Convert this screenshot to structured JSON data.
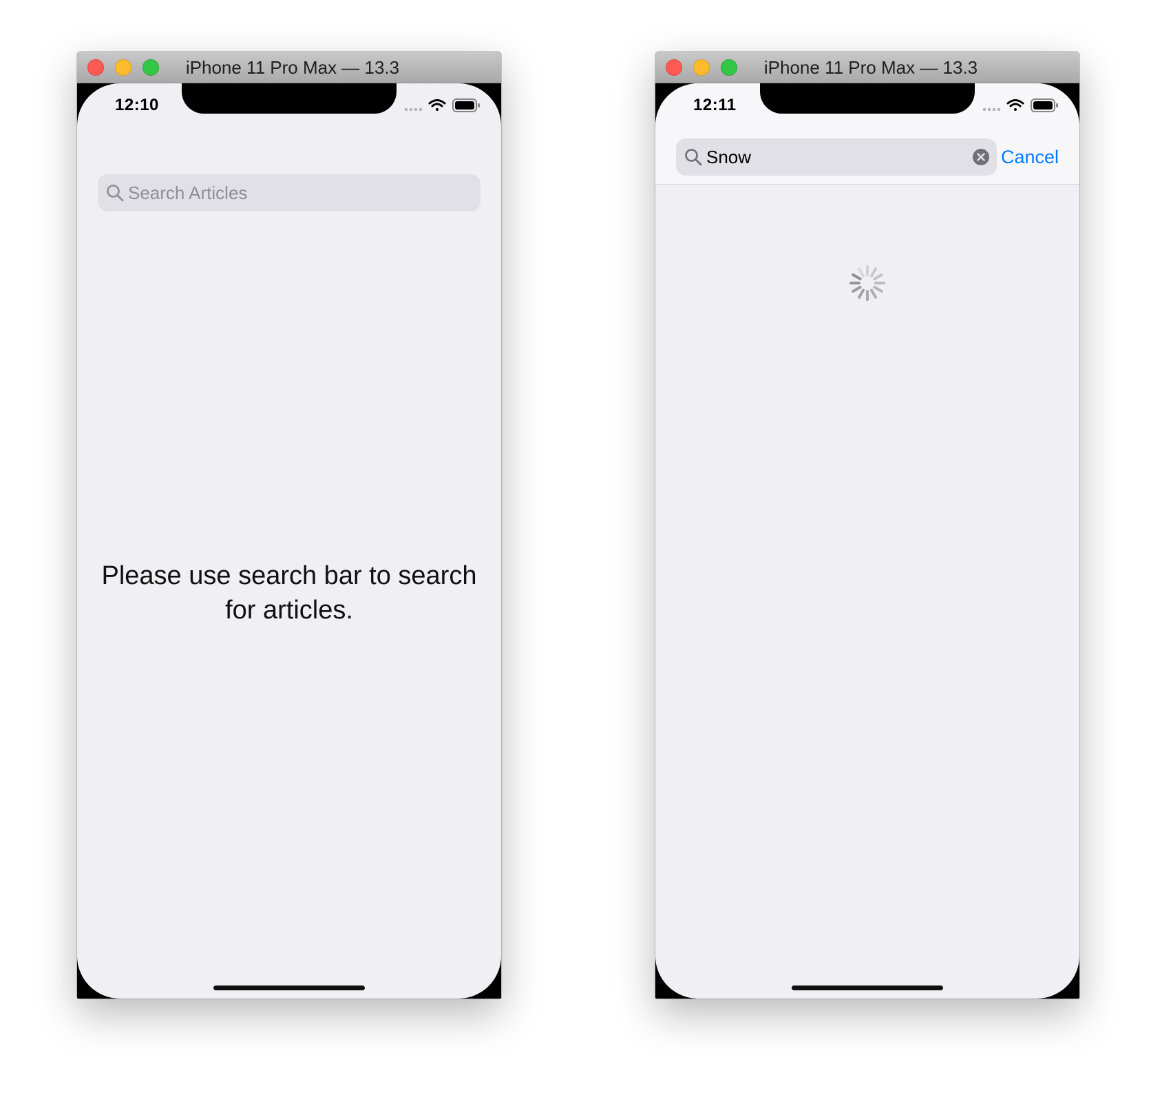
{
  "windows": [
    {
      "title": "iPhone 11 Pro Max — 13.3",
      "status_time": "12:10",
      "search": {
        "placeholder": "Search Articles",
        "value": ""
      },
      "message": "Please use search bar to search for articles."
    },
    {
      "title": "iPhone 11 Pro Max — 13.3",
      "status_time": "12:11",
      "search": {
        "placeholder": "",
        "value": "Snow"
      },
      "cancel_label": "Cancel",
      "loading": true
    }
  ],
  "icons": {
    "search": "search-icon",
    "clear": "clear-text-icon",
    "signal": "cellular-signal-icon",
    "wifi": "wifi-icon",
    "battery": "battery-icon",
    "spinner": "activity-indicator-icon"
  },
  "colors": {
    "tint": "#007aff",
    "background": "#efeff4",
    "search_field": "#e0e0e6",
    "placeholder": "#8e8e93",
    "close": "#fd5a52",
    "minimize": "#fdbb2d",
    "zoom": "#33c748"
  }
}
